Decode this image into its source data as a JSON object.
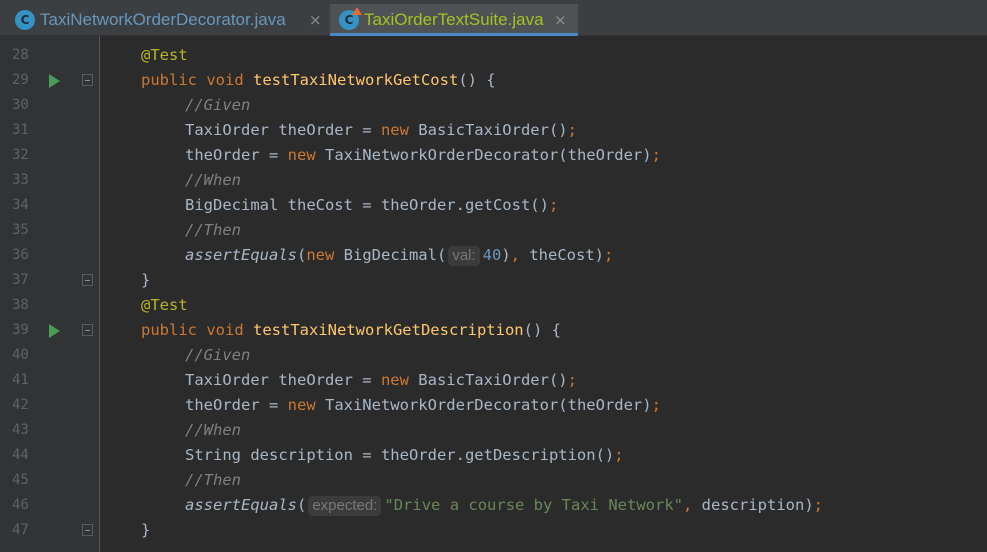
{
  "tabs": [
    {
      "icon": "C",
      "label": "TaxiNetworkOrderDecorator.java",
      "close": "×",
      "active": false
    },
    {
      "icon": "C",
      "label": "TaxiOrderTextSuite.java",
      "close": "×",
      "active": true
    }
  ],
  "editor": {
    "lines": [
      {
        "num": "28",
        "run": false,
        "fold": false,
        "indent": 1,
        "tokens": [
          {
            "c": "ann",
            "t": "@Test"
          }
        ]
      },
      {
        "num": "29",
        "run": true,
        "fold": true,
        "indent": 1,
        "tokens": [
          {
            "c": "kw",
            "t": "public "
          },
          {
            "c": "kw",
            "t": "void "
          },
          {
            "c": "fn",
            "t": "testTaxiNetworkGetCost"
          },
          {
            "c": "",
            "t": "() {"
          }
        ]
      },
      {
        "num": "30",
        "run": false,
        "fold": false,
        "indent": 2,
        "tokens": [
          {
            "c": "cm",
            "t": "//Given"
          }
        ]
      },
      {
        "num": "31",
        "run": false,
        "fold": false,
        "indent": 2,
        "tokens": [
          {
            "c": "",
            "t": "TaxiOrder theOrder = "
          },
          {
            "c": "kw",
            "t": "new "
          },
          {
            "c": "",
            "t": "BasicTaxiOrder()"
          },
          {
            "c": "kw",
            "t": ";"
          }
        ]
      },
      {
        "num": "32",
        "run": false,
        "fold": false,
        "indent": 2,
        "tokens": [
          {
            "c": "",
            "t": "theOrder = "
          },
          {
            "c": "kw",
            "t": "new "
          },
          {
            "c": "",
            "t": "TaxiNetworkOrderDecorator(theOrder)"
          },
          {
            "c": "kw",
            "t": ";"
          }
        ]
      },
      {
        "num": "33",
        "run": false,
        "fold": false,
        "indent": 2,
        "tokens": [
          {
            "c": "cm",
            "t": "//When"
          }
        ]
      },
      {
        "num": "34",
        "run": false,
        "fold": false,
        "indent": 2,
        "tokens": [
          {
            "c": "",
            "t": "BigDecimal theCost = theOrder.getCost()"
          },
          {
            "c": "kw",
            "t": ";"
          }
        ]
      },
      {
        "num": "35",
        "run": false,
        "fold": false,
        "indent": 2,
        "tokens": [
          {
            "c": "cm",
            "t": "//Then"
          }
        ]
      },
      {
        "num": "36",
        "run": false,
        "fold": false,
        "indent": 2,
        "tokens": [
          {
            "c": "it",
            "t": "assertEquals"
          },
          {
            "c": "",
            "t": "("
          },
          {
            "c": "kw",
            "t": "new "
          },
          {
            "c": "",
            "t": "BigDecimal("
          },
          {
            "c": "hint",
            "t": "val:"
          },
          {
            "c": "num",
            "t": "40"
          },
          {
            "c": "",
            "t": ")"
          },
          {
            "c": "kw",
            "t": ", "
          },
          {
            "c": "",
            "t": "theCost)"
          },
          {
            "c": "kw",
            "t": ";"
          }
        ]
      },
      {
        "num": "37",
        "run": false,
        "fold": true,
        "indent": 1,
        "tokens": [
          {
            "c": "",
            "t": "}"
          }
        ]
      },
      {
        "num": "38",
        "run": false,
        "fold": false,
        "indent": 1,
        "tokens": [
          {
            "c": "ann",
            "t": "@Test"
          }
        ]
      },
      {
        "num": "39",
        "run": true,
        "fold": true,
        "indent": 1,
        "tokens": [
          {
            "c": "kw",
            "t": "public "
          },
          {
            "c": "kw",
            "t": "void "
          },
          {
            "c": "fn",
            "t": "testTaxiNetworkGetDescription"
          },
          {
            "c": "",
            "t": "() {"
          }
        ]
      },
      {
        "num": "40",
        "run": false,
        "fold": false,
        "indent": 2,
        "tokens": [
          {
            "c": "cm",
            "t": "//Given"
          }
        ]
      },
      {
        "num": "41",
        "run": false,
        "fold": false,
        "indent": 2,
        "tokens": [
          {
            "c": "",
            "t": "TaxiOrder theOrder = "
          },
          {
            "c": "kw",
            "t": "new "
          },
          {
            "c": "",
            "t": "BasicTaxiOrder()"
          },
          {
            "c": "kw",
            "t": ";"
          }
        ]
      },
      {
        "num": "42",
        "run": false,
        "fold": false,
        "indent": 2,
        "tokens": [
          {
            "c": "",
            "t": "theOrder = "
          },
          {
            "c": "kw",
            "t": "new "
          },
          {
            "c": "",
            "t": "TaxiNetworkOrderDecorator(theOrder)"
          },
          {
            "c": "kw",
            "t": ";"
          }
        ]
      },
      {
        "num": "43",
        "run": false,
        "fold": false,
        "indent": 2,
        "tokens": [
          {
            "c": "cm",
            "t": "//When"
          }
        ]
      },
      {
        "num": "44",
        "run": false,
        "fold": false,
        "indent": 2,
        "tokens": [
          {
            "c": "",
            "t": "String description = theOrder.getDescription()"
          },
          {
            "c": "kw",
            "t": ";"
          }
        ]
      },
      {
        "num": "45",
        "run": false,
        "fold": false,
        "indent": 2,
        "tokens": [
          {
            "c": "cm",
            "t": "//Then"
          }
        ]
      },
      {
        "num": "46",
        "run": false,
        "fold": false,
        "indent": 2,
        "tokens": [
          {
            "c": "it",
            "t": "assertEquals"
          },
          {
            "c": "",
            "t": "("
          },
          {
            "c": "hint",
            "t": "expected:"
          },
          {
            "c": "str",
            "t": "\"Drive a course by Taxi Network\""
          },
          {
            "c": "kw",
            "t": ", "
          },
          {
            "c": "",
            "t": "description)"
          },
          {
            "c": "kw",
            "t": ";"
          }
        ]
      },
      {
        "num": "47",
        "run": false,
        "fold": true,
        "indent": 1,
        "tokens": [
          {
            "c": "",
            "t": "}"
          }
        ]
      }
    ]
  },
  "colors": {
    "keyword": "#cc7832",
    "annotation": "#bbb529",
    "function": "#ffc66d",
    "comment": "#808080",
    "string": "#6a8759",
    "number": "#6897bb",
    "text": "#a9b7c6",
    "background": "#2b2b2b"
  }
}
